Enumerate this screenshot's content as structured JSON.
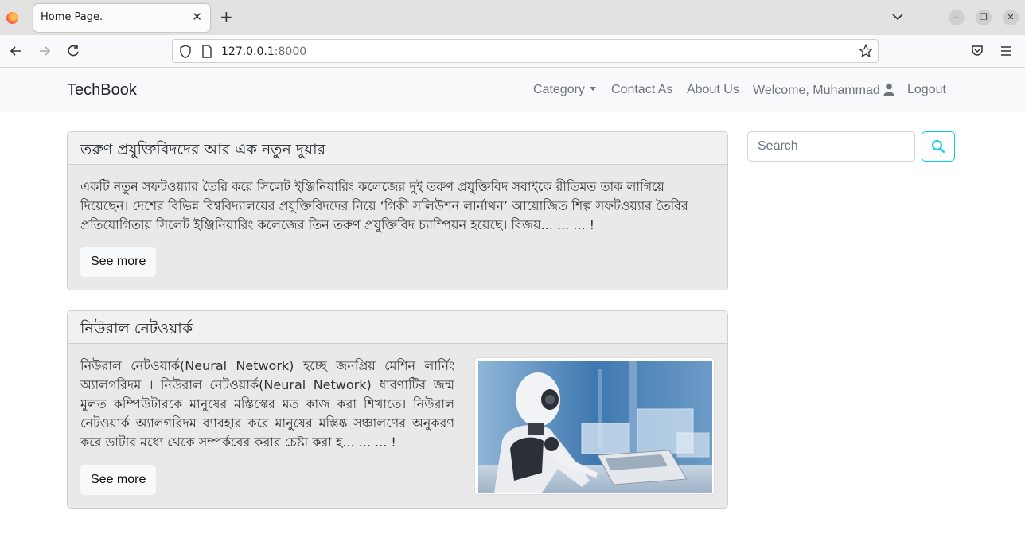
{
  "browser": {
    "tab_title": "Home Page.",
    "tab_close": "✕",
    "new_tab": "+",
    "url_host": "127.0.0.1",
    "url_port": ":8000",
    "minimize": "–",
    "restore": "❐",
    "close": "✕"
  },
  "site": {
    "brand": "TechBook",
    "nav": {
      "category": "Category",
      "contact": "Contact As",
      "about": "About Us",
      "welcome": "Welcome, Muhammad",
      "logout": "Logout"
    }
  },
  "search": {
    "placeholder": "Search"
  },
  "posts": [
    {
      "title": "তরুণ প্রযুক্তিবিদদের আর এক নতুন দুয়ার",
      "excerpt": "একটি নতুন সফটওয়্যার তৈরি করে সিলেট ইঞ্জিনিয়ারিং কলেজের দুই তরুণ প্রযুক্তিবিদ সবাইকে রীতিমত তাক লাগিয়ে দিয়েছেন। দেশের বিভিন্ন বিশ্ববিদ্যালয়ের প্রযুক্তিবিদদের নিয়ে ‘গিকী সলিউশন লার্নাথন’ আয়োজিত শিল্প সফটওয়্যার তৈরির প্রতিযোগিতায় সিলেট ইঞ্জিনিয়ারিং কলেজের তিন তরুণ প্রযুক্তিবিদ চ্যাম্পিয়ন হয়েছে। বিজয়... ... ... !",
      "button": "See more"
    },
    {
      "title": "নিউরাল নেটওয়ার্ক",
      "excerpt": "নিউরাল নেটওয়ার্ক(Neural Network) হচ্ছে জনপ্রিয় মেশিন লার্নিং অ্যালগরিদম । নিউরাল নেটওয়ার্ক(Neural Network) ধারণাটির জন্ম মুলত কম্পিউটারকে মানুষের মস্তিস্কের মত কাজ করা শিখাতে। নিউরাল নেটওয়ার্ক অ্যালগরিদম ব্যাবহার করে মানুষের মস্তিষ্ক সঞ্চালণের অনুকরণ করে ডাটার মধ্যে থেকে সম্পর্কবের করার চেষ্টা করা হ... ... ... !",
      "button": "See more",
      "image": "robot-using-laptop"
    }
  ],
  "colors": {
    "search_accent": "#0dcaf0",
    "card_bg": "#e9e9e9",
    "navbar_bg": "#f8f9fa"
  }
}
